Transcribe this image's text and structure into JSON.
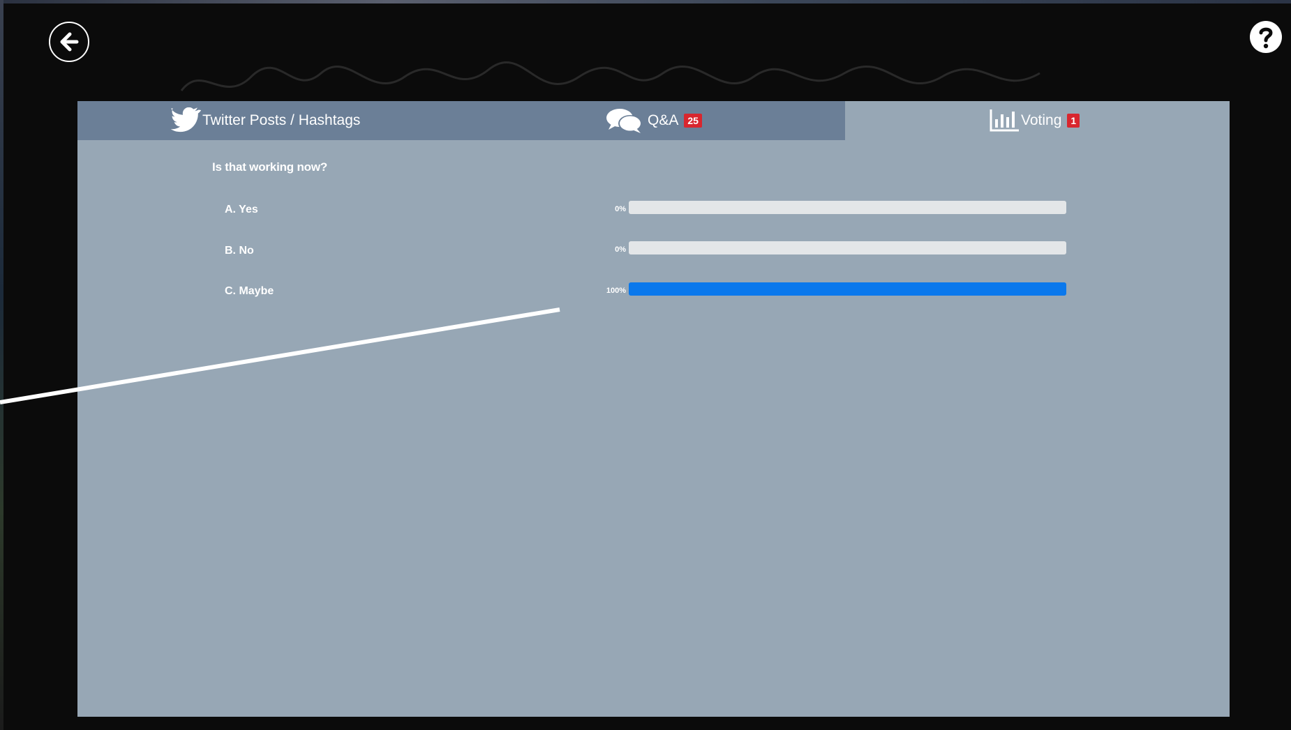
{
  "nav": {
    "back_icon": "arrow-left-icon",
    "help_icon": "question-mark-icon"
  },
  "tabs": [
    {
      "label": "Twitter Posts / Hashtags",
      "icon": "twitter-bird-icon",
      "badge": ""
    },
    {
      "label": "Q&A",
      "icon": "speech-bubbles-icon",
      "badge": "25"
    },
    {
      "label": "Voting",
      "icon": "bar-chart-icon",
      "badge": "1"
    }
  ],
  "poll": {
    "question": "Is that working now?",
    "options": [
      {
        "label": "A. Yes",
        "percent_text": "0%",
        "percent": 0
      },
      {
        "label": "B. No",
        "percent_text": "0%",
        "percent": 0
      },
      {
        "label": "C. Maybe",
        "percent_text": "100%",
        "percent": 100
      }
    ]
  },
  "colors": {
    "panel": "#97a7b5",
    "tab_bar": "#6b7f97",
    "badge": "#d9262e",
    "bar_fill": "#0a78ec",
    "bar_track": "#e3e6e8"
  }
}
